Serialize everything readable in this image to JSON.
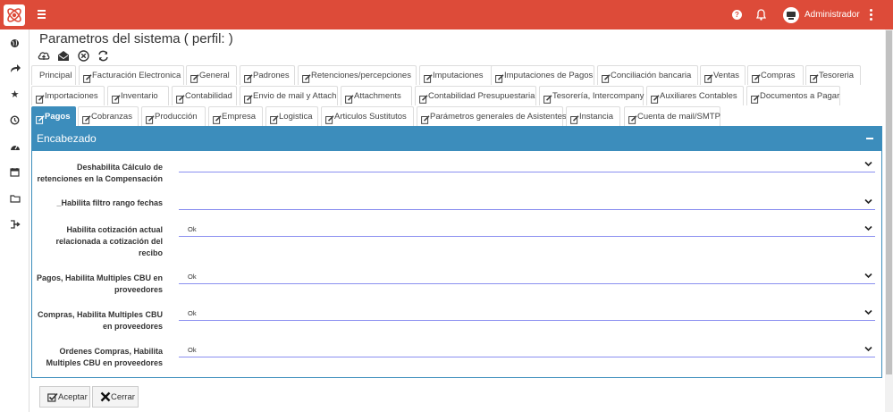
{
  "header": {
    "user_name": "Administrador",
    "help_glyph": "?",
    "brand_color": "#dd4b39"
  },
  "sidebar": {
    "icons": [
      "globe-icon",
      "share-icon",
      "star-icon",
      "clock-icon",
      "dashboard-icon",
      "calendar-icon",
      "folder-icon",
      "logout-icon"
    ]
  },
  "page": {
    "title": "Parametros del sistema ( perfil: )"
  },
  "toolbar": {
    "icons": [
      "upload-cloud-icon",
      "mail-open-icon",
      "cancel-circle-icon",
      "refresh-icon"
    ]
  },
  "tabs": {
    "row1": [
      {
        "label": "Principal",
        "icon": false
      },
      {
        "label": "Facturación Electronica",
        "icon": true
      },
      {
        "label": "General",
        "icon": true
      },
      {
        "label": "Padrones",
        "icon": true
      },
      {
        "label": "Retenciones/percepciones",
        "icon": true
      },
      {
        "label": "Imputaciones",
        "icon": true
      },
      {
        "label": "Imputaciones de Pagos",
        "icon": true
      },
      {
        "label": "Conciliación bancaria",
        "icon": true
      },
      {
        "label": "Ventas",
        "icon": true
      },
      {
        "label": "Compras",
        "icon": true
      },
      {
        "label": "Tesoreria",
        "icon": true
      }
    ],
    "row2": [
      {
        "label": "Importaciones",
        "icon": true
      },
      {
        "label": "Inventario",
        "icon": true
      },
      {
        "label": "Contabilidad",
        "icon": true
      },
      {
        "label": "Envio de mail y Attach",
        "icon": true
      },
      {
        "label": "Attachments",
        "icon": true
      },
      {
        "label": "Contabilidad Presupuestaria",
        "icon": true
      },
      {
        "label": "Tesorería, Intercompany",
        "icon": true
      },
      {
        "label": "Auxiliares Contables",
        "icon": true
      },
      {
        "label": "Documentos a Pagar",
        "icon": true
      }
    ],
    "row3": [
      {
        "label": "Pagos",
        "icon": true,
        "active": true
      },
      {
        "label": "Cobranzas",
        "icon": true
      },
      {
        "label": "Producción",
        "icon": true
      },
      {
        "label": "Empresa",
        "icon": true
      },
      {
        "label": "Logistica",
        "icon": true
      },
      {
        "label": "Articulos Sustitutos",
        "icon": true
      },
      {
        "label": "Parámetros generales de Asistentes",
        "icon": true
      },
      {
        "label": "Instancia",
        "icon": true
      },
      {
        "label": "Cuenta de mail/SMTP",
        "icon": true
      }
    ],
    "active_color": "#3c8dbc"
  },
  "panel": {
    "title": "Encabezado",
    "fields": [
      {
        "label_lines": [
          "Deshabilita Cálculo de",
          "retenciones en la Compensación"
        ],
        "value": ""
      },
      {
        "label_lines": [
          "_Habilita filtro rango fechas"
        ],
        "value": ""
      },
      {
        "label_lines": [
          "Habilita cotización actual",
          "relacionada a cotización del",
          "recibo"
        ],
        "value": "Ok"
      },
      {
        "label_lines": [
          "Pagos, Habilita Multiples CBU en",
          "proveedores"
        ],
        "value": "Ok"
      },
      {
        "label_lines": [
          "Compras, Habilita Multiples CBU",
          "en proveedores"
        ],
        "value": "Ok"
      },
      {
        "label_lines": [
          "Ordenes Compras, Habilita",
          "Multiples CBU en proveedores"
        ],
        "value": "Ok"
      }
    ]
  },
  "footer": {
    "accept_label": "Aceptar",
    "close_label": "Cerrar"
  }
}
